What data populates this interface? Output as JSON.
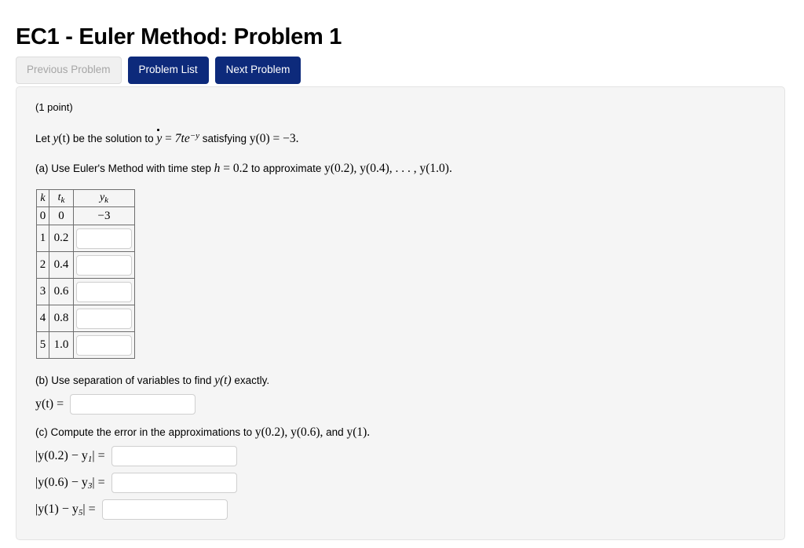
{
  "page": {
    "title": "EC1 - Euler Method: Problem 1",
    "accent_color": "#0d2a7b",
    "panel_background": "#f5f5f5"
  },
  "nav_buttons": [
    {
      "label": "Previous Problem",
      "state": "disabled"
    },
    {
      "label": "Problem List",
      "state": "primary"
    },
    {
      "label": "Next Problem",
      "state": "primary"
    }
  ],
  "problem": {
    "points": "(1 point)",
    "intro": {
      "prefix": "Let ",
      "function": "y",
      "variable": "(t)",
      "middle": " be the solution to ",
      "equation_lhs": "y",
      "equation_eq": " = ",
      "equation_rhs_coef": "7te",
      "equation_rhs_exp": "−y",
      "suffix": " satisfying ",
      "initial_condition": "y(0) = −3."
    },
    "part_a": {
      "text_1": "(a) Use Euler's Method with time step ",
      "h_var": "h",
      "h_eq": " = 0.2",
      "text_2": " to approximate ",
      "targets": "y(0.2),  y(0.4), . . . , y(1.0)."
    },
    "table": {
      "headers": [
        {
          "base": "k",
          "sub": ""
        },
        {
          "base": "t",
          "sub": "k"
        },
        {
          "base": "y",
          "sub": "k"
        }
      ],
      "rows": [
        {
          "k": "0",
          "t": "0",
          "y": "−3",
          "y_is_input": false
        },
        {
          "k": "1",
          "t": "0.2",
          "y": "",
          "y_is_input": true
        },
        {
          "k": "2",
          "t": "0.4",
          "y": "",
          "y_is_input": true
        },
        {
          "k": "3",
          "t": "0.6",
          "y": "",
          "y_is_input": true
        },
        {
          "k": "4",
          "t": "0.8",
          "y": "",
          "y_is_input": true
        },
        {
          "k": "5",
          "t": "1.0",
          "y": "",
          "y_is_input": true
        }
      ]
    },
    "part_b": {
      "text": "(b) Use separation of variables to find ",
      "target": "y(t)",
      "text_end": " exactly.",
      "answer_label": "y(t) =",
      "answer_value": ""
    },
    "part_c": {
      "text": "(c) Compute the error in the approximations to ",
      "targets": "y(0.2),  y(0.6),",
      "text_mid": " and ",
      "target_last": "y(1).",
      "errors": [
        {
          "label_open": "|y(0.2) − y",
          "label_sub": "1",
          "label_close": "| =",
          "value": ""
        },
        {
          "label_open": "|y(0.6) − y",
          "label_sub": "3",
          "label_close": "| =",
          "value": ""
        },
        {
          "label_open": "|y(1) − y",
          "label_sub": "5",
          "label_close": "| =",
          "value": ""
        }
      ]
    }
  }
}
